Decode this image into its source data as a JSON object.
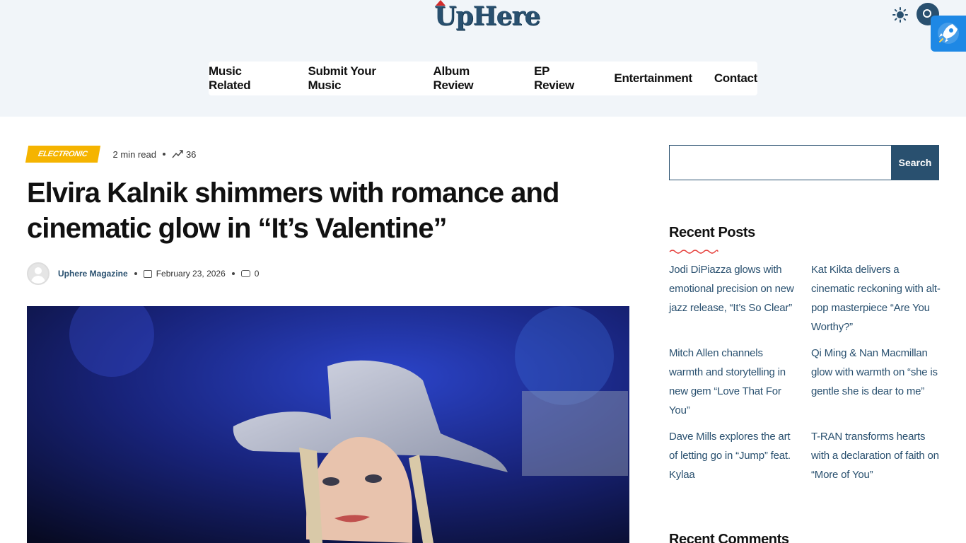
{
  "header": {
    "logo_text": "UpHere",
    "icons": [
      "sun-icon",
      "search-icon",
      "rocket-icon"
    ]
  },
  "nav": {
    "items": [
      "Music Related",
      "Submit Your Music",
      "Album Review",
      "EP Review",
      "Entertainment",
      "Contact"
    ]
  },
  "article": {
    "category": "ELECTRONIC",
    "read_time": "2 min read",
    "views": "36",
    "title": "Elvira Kalnik shimmers with romance and cinematic glow in “It’s Valentine”",
    "author": "Uphere Magazine",
    "date": "February 23, 2026",
    "comments": "0"
  },
  "sidebar": {
    "search_button": "Search",
    "search_value": "",
    "recent_posts_title": "Recent Posts",
    "recent_posts": [
      "Jodi DiPiazza glows with emotional precision on new jazz release, “It’s So Clear”",
      "Kat Kikta delivers a cinematic reckoning with alt-pop masterpiece “Are You Worthy?”",
      "Mitch Allen channels warmth and storytelling in new gem “Love That For You”",
      "Qi Ming & Nan Macmillan glow with warmth on “she is gentle she is dear to me”",
      "Dave Mills explores the art of letting go in “Jump” feat. Kylaa",
      "T-RAN transforms hearts with a declaration of faith on “More of You”"
    ],
    "recent_comments_title": "Recent Comments"
  },
  "colors": {
    "brand": "#29506f",
    "badge": "#f5b400",
    "header_bg": "#f1f5f9",
    "accent_wave": "#e53935"
  }
}
